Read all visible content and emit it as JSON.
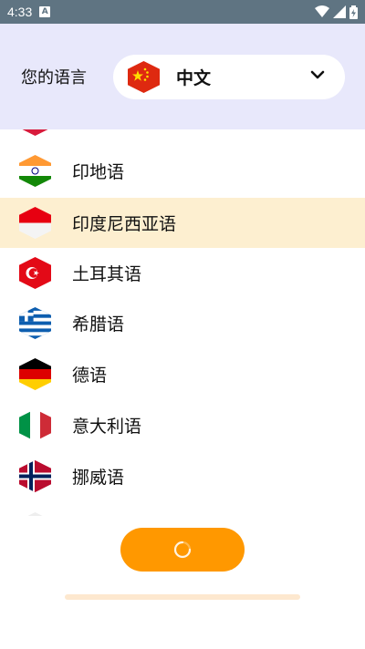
{
  "status_bar": {
    "time": "4:33",
    "notification_letter": "A"
  },
  "header": {
    "label": "您的语言",
    "selected_language": "中文"
  },
  "languages": [
    {
      "label": "",
      "flag": "partial-red-flag"
    },
    {
      "label": "印地语",
      "flag": "india-flag"
    },
    {
      "label": "印度尼西亚语",
      "flag": "indonesia-flag",
      "selected": true
    },
    {
      "label": "土耳其语",
      "flag": "turkey-flag"
    },
    {
      "label": "希腊语",
      "flag": "greece-flag"
    },
    {
      "label": "德语",
      "flag": "germany-flag"
    },
    {
      "label": "意大利语",
      "flag": "italy-flag"
    },
    {
      "label": "挪威语",
      "flag": "norway-flag"
    }
  ],
  "colors": {
    "status_bar": "#5f7482",
    "header_bg": "#e8e8fb",
    "selected_row": "#fdefd0",
    "button": "#ff9800"
  },
  "button": {
    "state": "loading"
  }
}
